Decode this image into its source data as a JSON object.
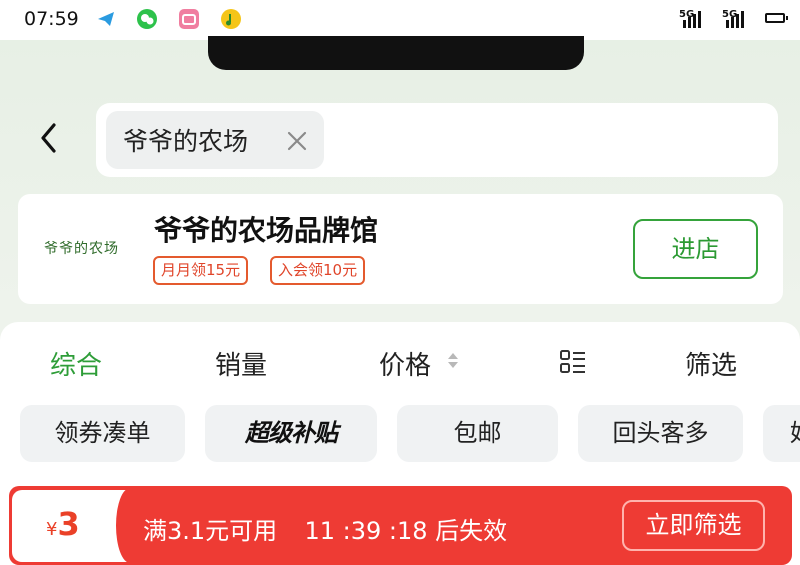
{
  "status_bar": {
    "time": "07:59",
    "apps": [
      "telegram-icon",
      "wechat-icon",
      "bilibili-icon",
      "qq-music-icon"
    ],
    "network": [
      "5G",
      "5G"
    ],
    "battery_icon": "battery-icon"
  },
  "search": {
    "back_icon": "chevron-left-icon",
    "query_chip": "爷爷的农场",
    "clear_icon": "close-icon"
  },
  "store": {
    "logo_text": "爷爷的农场",
    "name": "爷爷的农场品牌馆",
    "coupons": [
      "月月领15元",
      "入会领10元"
    ],
    "enter_label": "进店"
  },
  "sort_tabs": [
    {
      "label": "综合",
      "active": true
    },
    {
      "label": "销量",
      "active": false
    },
    {
      "label": "价格",
      "active": false
    },
    {
      "label": "筛选",
      "active": false
    }
  ],
  "filters": [
    "领券凑单",
    "超级补贴",
    "包邮",
    "回头客多",
    "好"
  ],
  "coupon_banner": {
    "currency": "¥",
    "amount": "3",
    "condition": "满3.1元可用",
    "countdown": "11 :39 :18",
    "expire_suffix": "后失效",
    "button_label": "立即筛选"
  },
  "colors": {
    "accent_green": "#2e9d38",
    "banner_red": "#ee3b34",
    "coupon_orange": "#e0452a"
  }
}
